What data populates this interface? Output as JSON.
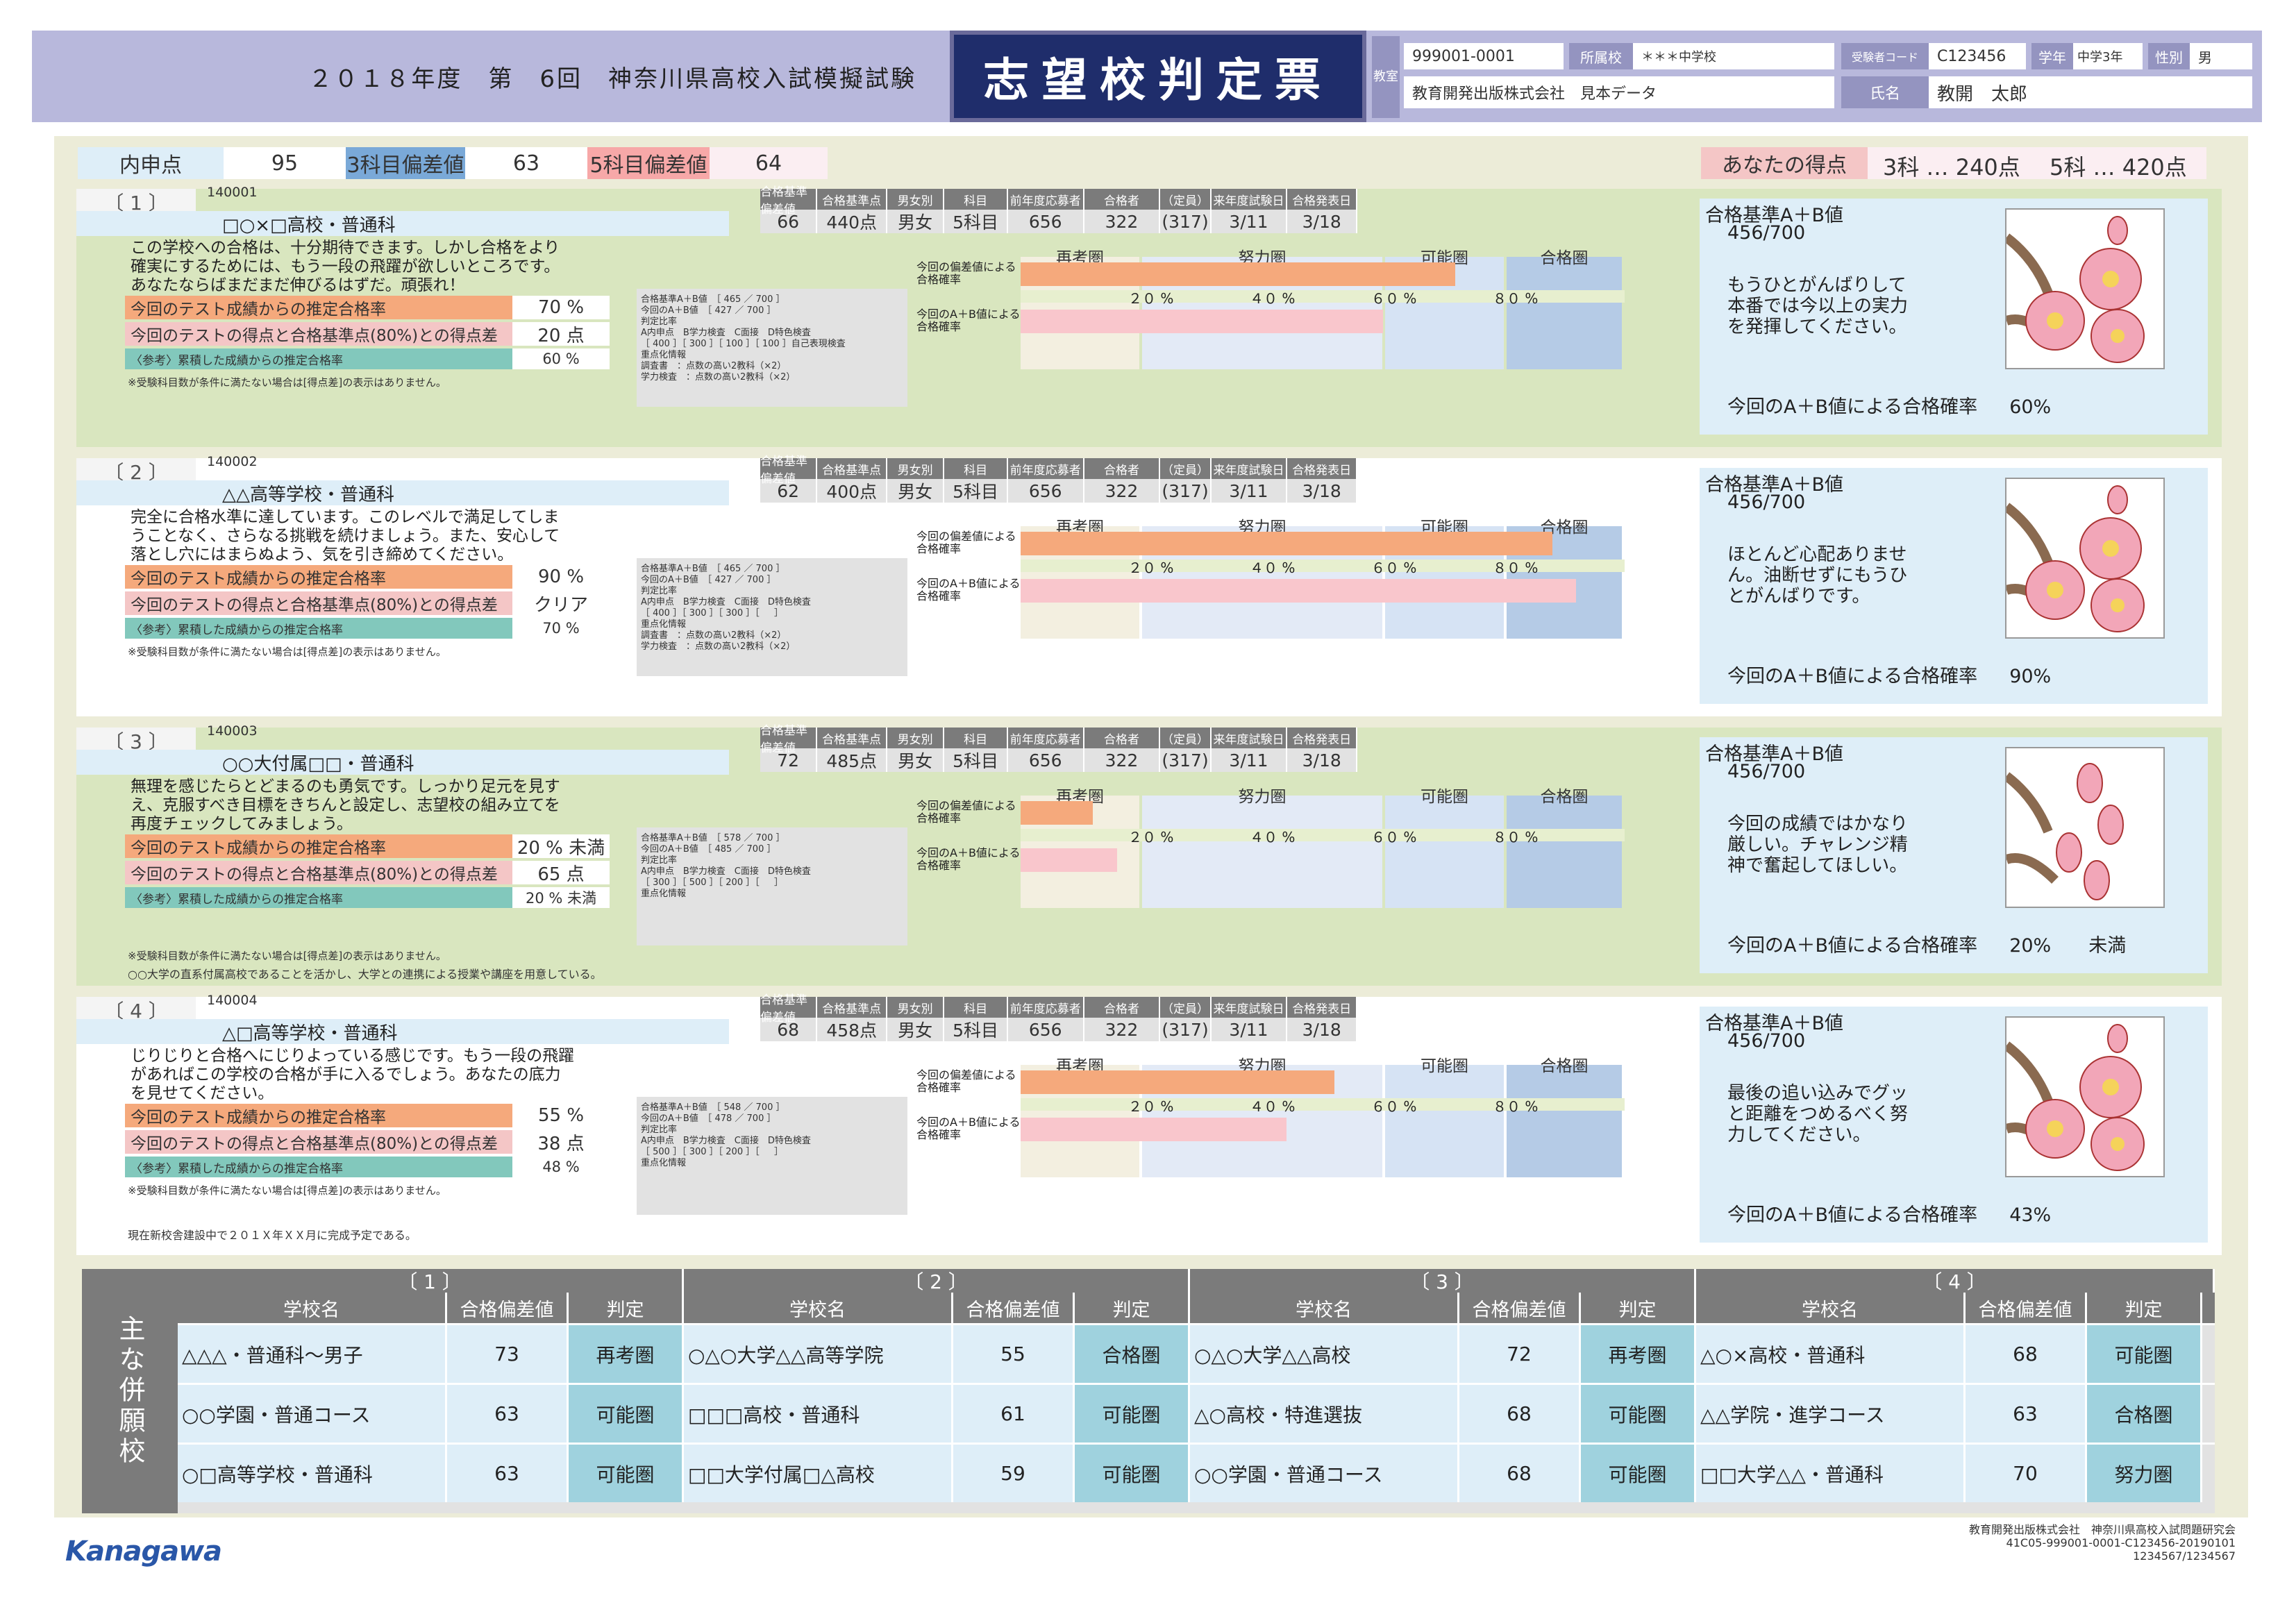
{
  "header": {
    "exam_title": "２０１８年度　第　6回　神奈川県高校入試模擬試験",
    "doc_title": "志望校判定票",
    "labels": {
      "classroom": "教室",
      "school": "所属校",
      "examinee_code": "受験者コード",
      "grade": "学年",
      "gender": "性別",
      "name": "氏名"
    },
    "values": {
      "id": "999001-0001",
      "school": "＊＊＊中学校",
      "examinee_code": "C123456",
      "grade": "中学3年",
      "gender": "男",
      "org": "教育開発出版株式会社　見本データ",
      "name": "教開　太郎"
    }
  },
  "scores": {
    "naishin_label": "内申点",
    "naishin": "95",
    "dev3_label": "3科目偏差値",
    "dev3": "63",
    "dev5_label": "5科目偏差値",
    "dev5": "64",
    "yours_label": "あなたの得点",
    "yours3": "3科 … 240点",
    "yours5": "5科 … 420点"
  },
  "stat_headers": [
    "合格基準偏差値",
    "合格基準点",
    "男女別",
    "科目",
    "前年度応募者",
    "合格者",
    "（定員）",
    "来年度試験日",
    "合格発表日"
  ],
  "zones": [
    "再考圏",
    "努力圏",
    "可能圏",
    "合格圏"
  ],
  "pct_ticks": [
    "２０ %",
    "４０ %",
    "６０ %",
    "８０ %"
  ],
  "row_labels": {
    "est": "今回のテスト成績からの推定合格率",
    "diff": "今回のテストの得点と合格基準点(80%)との得点差",
    "ref": "〈参考〉累積した成績からの推定合格率",
    "note": "※受験科目数が条件に満たない場合は[得点差]の表示はありません。",
    "g_dev": "今回の偏差値による合格確率",
    "g_ab": "今回のA＋B値による合格確率",
    "crit": "合格基準A＋B値",
    "prob_label": "今回のA＋B値による合格確率"
  },
  "schools": [
    {
      "num": "〔 1 〕",
      "code": "140001",
      "name": "□○×□高校・普通科",
      "comment": "この学校への合格は、十分期待できます。しかし合格をより確実にするためには、もう一段の飛躍が欲しいところです。あなたならばまだまだ伸びるはずだ。頑張れ！",
      "est": "70 %",
      "diff": "20 点",
      "ref": "60 %",
      "stats": [
        "66",
        "440点",
        "男女",
        "5科目",
        "656",
        "322",
        "(317)",
        "3/11",
        "3/18"
      ],
      "gray": [
        "合格基準A＋B値　［ 465 ／ 700 ］",
        "今回のA＋B値　［ 427 ／ 700 ］",
        "判定比率",
        "A内申点　B学力検査　C面接　D特色検査",
        "［ 400 ］［ 300 ］［ 100 ］［ 100 ］自己表現検査",
        "重点化情報",
        "調査書　：点数の高い2教科（×2）",
        "学力検査　：点数の高い2教科（×2）"
      ],
      "bar_dev": 0.72,
      "bar_ab": 0.6,
      "crit": "456/700",
      "advice": "もうひとがんばりして本番では今以上の実力を発揮してください。",
      "prob": "60%",
      "foot": ""
    },
    {
      "num": "〔 2 〕",
      "code": "140002",
      "name": "△△高等学校・普通科",
      "comment": "完全に合格水準に達しています。このレベルで満足してしまうことなく、さらなる挑戦を続けましょう。また、安心して落とし穴にはまらぬよう、気を引き締めてください。",
      "est": "90 %",
      "diff": "クリア",
      "ref": "70 %",
      "stats": [
        "62",
        "400点",
        "男女",
        "5科目",
        "656",
        "322",
        "(317)",
        "3/11",
        "3/18"
      ],
      "gray": [
        "合格基準A＋B値　［ 465 ／ 700 ］",
        "今回のA＋B値　［ 427 ／ 700 ］",
        "判定比率",
        "A内申点　B学力検査　C面接　D特色検査",
        "［ 400 ］［ 300 ］［ 300 ］［ 　 ］",
        "重点化情報",
        "調査書　：点数の高い2教科（×2）",
        "学力検査　：点数の高い2教科（×2）"
      ],
      "bar_dev": 0.88,
      "bar_ab": 0.92,
      "crit": "456/700",
      "advice": "ほとんど心配ありません。油断せずにもうひとがんばりです。",
      "prob": "90%",
      "foot": ""
    },
    {
      "num": "〔 3 〕",
      "code": "140003",
      "name": "○○大付属□□・普通科",
      "comment": "無理を感じたらとどまるのも勇気です。しっかり足元を見すえ、克服すべき目標をきちんと設定し、志望校の組み立てを再度チェックしてみましょう。",
      "est": "20 % 未満",
      "diff": "65 点",
      "ref": "20 % 未満",
      "stats": [
        "72",
        "485点",
        "男女",
        "5科目",
        "656",
        "322",
        "(317)",
        "3/11",
        "3/18"
      ],
      "gray": [
        "合格基準A＋B値　［ 578 ／ 700 ］",
        "今回のA＋B値　［ 485 ／ 700 ］",
        "判定比率",
        "A内申点　B学力検査　C面接　D特色検査",
        "［ 300 ］［ 500 ］［ 200 ］［ 　 ］",
        "重点化情報"
      ],
      "bar_dev": 0.12,
      "bar_ab": 0.16,
      "crit": "456/700",
      "advice": "今回の成績ではかなり厳しい。チャレンジ精神で奮起してほしい。",
      "prob": "20%　　未満",
      "foot": "○○大学の直系付属高校であることを活かし、大学との連携による授業や講座を用意している。"
    },
    {
      "num": "〔 4 〕",
      "code": "140004",
      "name": "△□高等学校・普通科",
      "comment": "じりじりと合格へにじりよっている感じです。もう一段の飛躍があればこの学校の合格が手に入るでしょう。あなたの底力を見せてください。",
      "est": "55 %",
      "diff": "38 点",
      "ref": "48 %",
      "stats": [
        "68",
        "458点",
        "男女",
        "5科目",
        "656",
        "322",
        "(317)",
        "3/11",
        "3/18"
      ],
      "gray": [
        "合格基準A＋B値　［ 548 ／ 700 ］",
        "今回のA＋B値　［ 478 ／ 700 ］",
        "判定比率",
        "A内申点　B学力検査　C面接　D特色検査",
        "［ 500 ］［ 300 ］［ 200 ］［ 　 ］",
        "重点化情報"
      ],
      "bar_dev": 0.52,
      "bar_ab": 0.44,
      "crit": "456/700",
      "advice": "最後の追い込みでグッと距離をつめるべく努力してください。",
      "prob": "43%",
      "foot": "現在新校舎建設中で２０１Ｘ年ＸＸ月に完成予定である。"
    }
  ],
  "bottom": {
    "side": "主な併願校",
    "col_school": "学校名",
    "col_dev": "合格偏差値",
    "col_judge": "判定",
    "groups": [
      {
        "title": "〔 1 〕",
        "rows": [
          [
            "△△△・普通科～男子",
            "73",
            "再考圏"
          ],
          [
            "○○学園・普通コース",
            "63",
            "可能圏"
          ],
          [
            "○□高等学校・普通科",
            "63",
            "可能圏"
          ]
        ]
      },
      {
        "title": "〔 2 〕",
        "rows": [
          [
            "○△○大学△△高等学院",
            "55",
            "合格圏"
          ],
          [
            "□□□高校・普通科",
            "61",
            "可能圏"
          ],
          [
            "□□大学付属□△高校",
            "59",
            "可能圏"
          ]
        ]
      },
      {
        "title": "〔 3 〕",
        "rows": [
          [
            "○△○大学△△高校",
            "72",
            "再考圏"
          ],
          [
            "△○高校・特進選抜",
            "68",
            "可能圏"
          ],
          [
            "○○学園・普通コース",
            "68",
            "可能圏"
          ]
        ]
      },
      {
        "title": "〔 4 〕",
        "rows": [
          [
            "△○×高校・普通科",
            "68",
            "可能圏"
          ],
          [
            "△△学院・進学コース",
            "63",
            "合格圏"
          ],
          [
            "□□大学△△・普通科",
            "70",
            "努力圏"
          ]
        ]
      }
    ]
  },
  "footer": {
    "logo": "Kanagawa",
    "line1": "教育開発出版株式会社　神奈川県高校入試問題研究会",
    "line2": "41C05-999001-0001-C123456-20190101",
    "line3": "1234567/1234567"
  },
  "colors": {
    "orange": "#f5a97c",
    "pink": "#f9c6cc",
    "teal": "#82c8bc",
    "header": "#1f2d6b"
  }
}
